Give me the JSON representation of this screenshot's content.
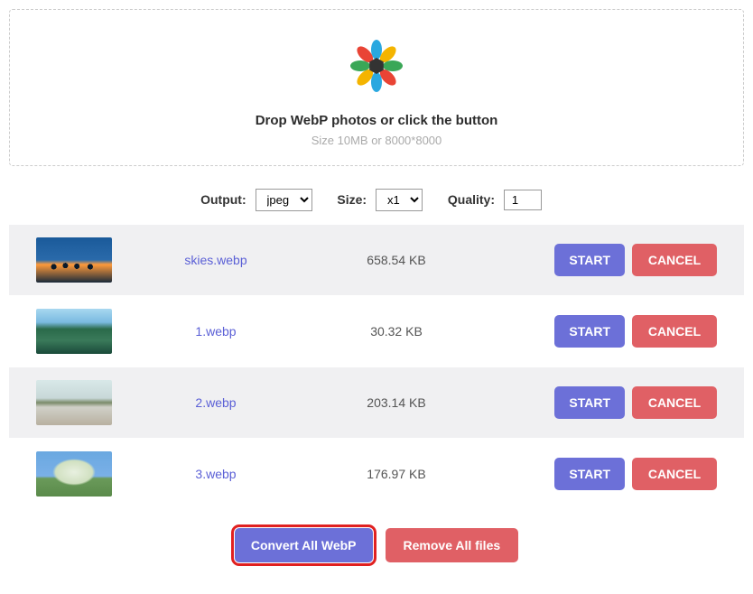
{
  "dropzone": {
    "title": "Drop WebP photos or click the button",
    "subtitle": "Size 10MB or 8000*8000"
  },
  "options": {
    "output_label": "Output:",
    "output_value": "jpeg",
    "size_label": "Size:",
    "size_value": "x1",
    "quality_label": "Quality:",
    "quality_value": "1"
  },
  "files": [
    {
      "name": "skies.webp",
      "size": "658.54 KB"
    },
    {
      "name": "1.webp",
      "size": "30.32 KB"
    },
    {
      "name": "2.webp",
      "size": "203.14 KB"
    },
    {
      "name": "3.webp",
      "size": "176.97 KB"
    }
  ],
  "buttons": {
    "start": "START",
    "cancel": "CANCEL",
    "convert_all": "Convert All WebP",
    "remove_all": "Remove All files"
  },
  "colors": {
    "primary": "#6c70d8",
    "danger": "#e06065",
    "highlight": "#e02020",
    "link": "#5a5fd6"
  }
}
